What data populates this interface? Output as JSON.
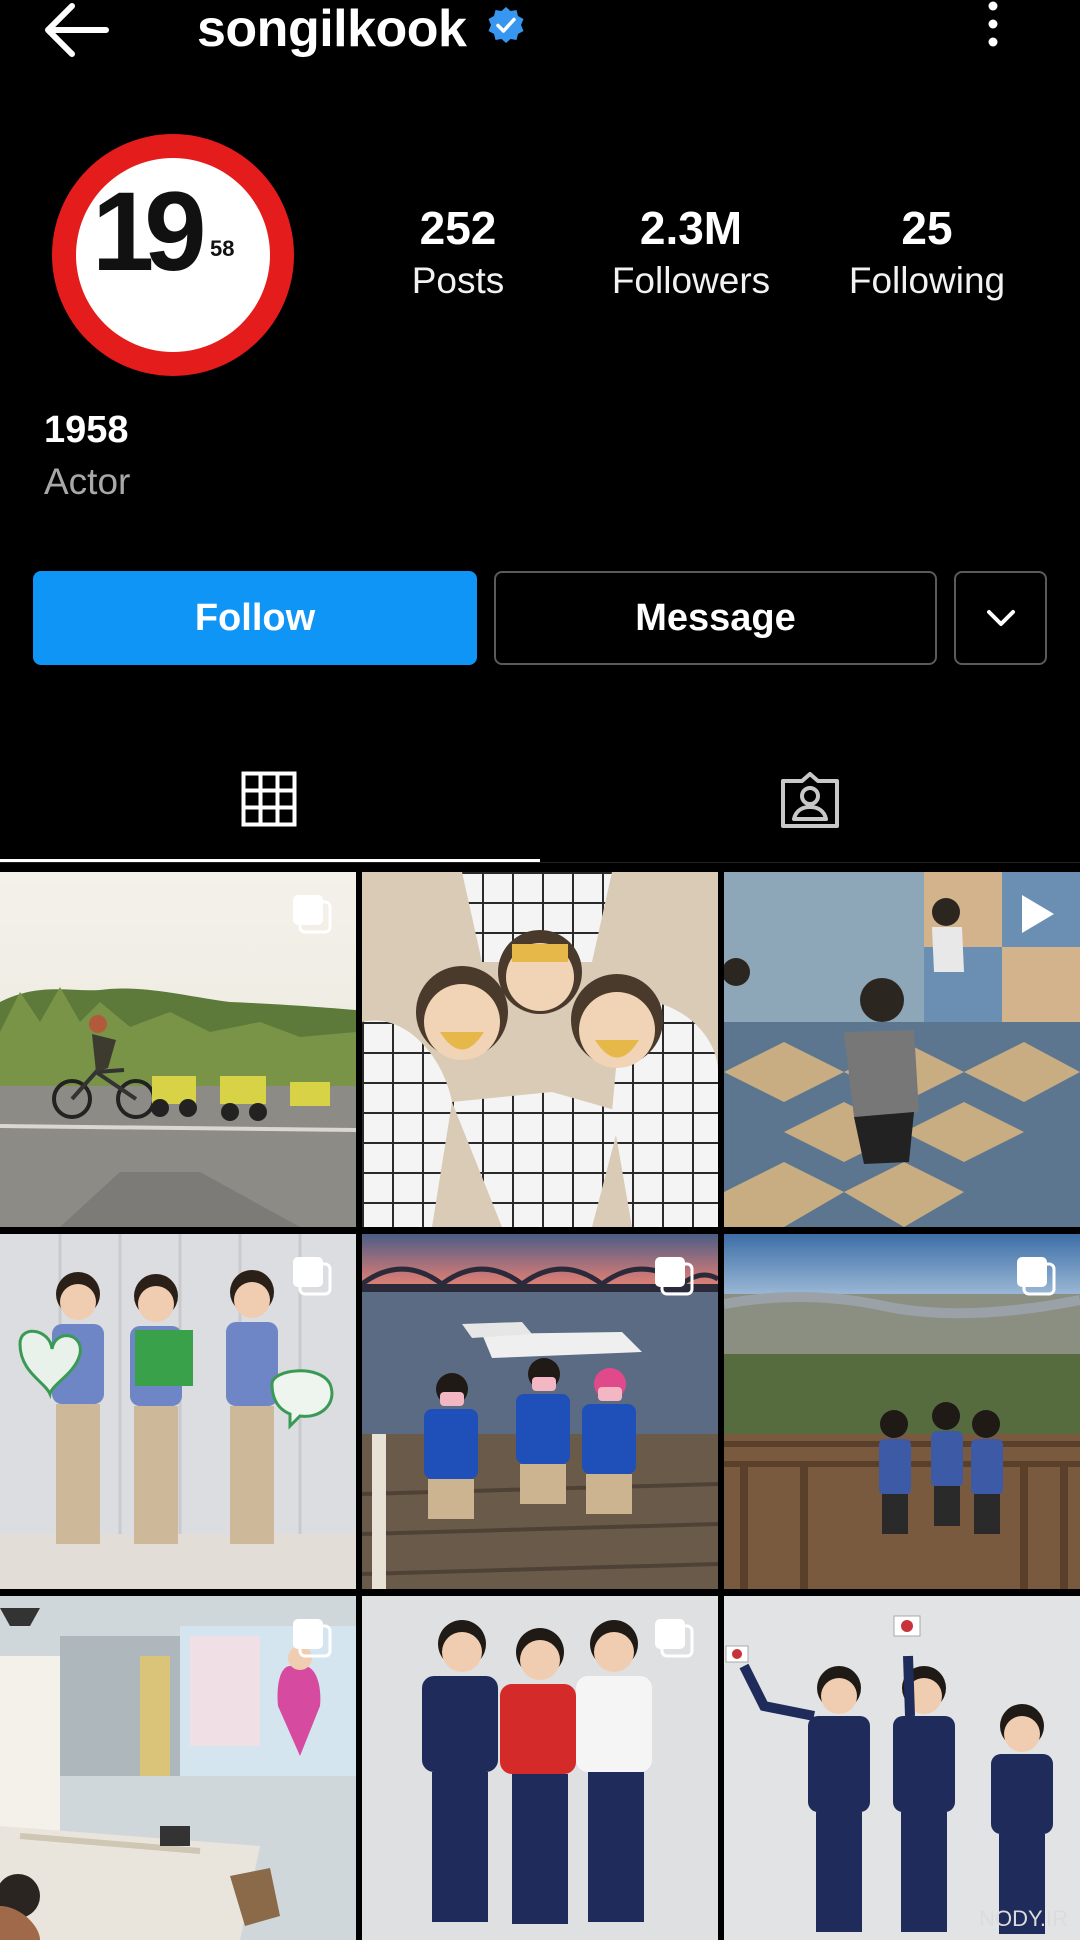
{
  "header": {
    "username": "songilkook",
    "verified_icon": "verified-badge-icon",
    "back_icon": "arrow-left-icon",
    "more_icon": "more-vertical-icon"
  },
  "avatar": {
    "big_text": "19",
    "small_text": "58",
    "ring_color": "#e41c1c"
  },
  "stats": {
    "posts": {
      "value": "252",
      "label": "Posts"
    },
    "followers": {
      "value": "2.3M",
      "label": "Followers"
    },
    "following": {
      "value": "25",
      "label": "Following"
    }
  },
  "bio": {
    "name": "1958",
    "category": "Actor"
  },
  "actions": {
    "follow_label": "Follow",
    "message_label": "Message",
    "dropdown_icon": "chevron-down-icon",
    "follow_color": "#0f95f6"
  },
  "tabs": [
    {
      "name": "posts-grid",
      "icon": "grid-icon",
      "active": true
    },
    {
      "name": "tagged",
      "icon": "tagged-person-icon",
      "active": false
    }
  ],
  "posts": [
    {
      "subject": "cyclist with bike trailers",
      "badge": "multiple-photos-icon"
    },
    {
      "subject": "three kids lying in masks",
      "badge": "none"
    },
    {
      "subject": "toddlers in play room",
      "badge": "video-play-icon"
    },
    {
      "subject": "three boys holding signs",
      "badge": "multiple-photos-icon"
    },
    {
      "subject": "three boys at harbor sunset",
      "badge": "multiple-photos-icon"
    },
    {
      "subject": "boys on city overlook deck",
      "badge": "multiple-photos-icon"
    },
    {
      "subject": "classroom with tables",
      "badge": "multiple-photos-icon"
    },
    {
      "subject": "three boys in polo shirts",
      "badge": "multiple-photos-icon"
    },
    {
      "subject": "three boys in suits with flags",
      "badge": "none"
    }
  ],
  "watermark": "NODY.IR"
}
